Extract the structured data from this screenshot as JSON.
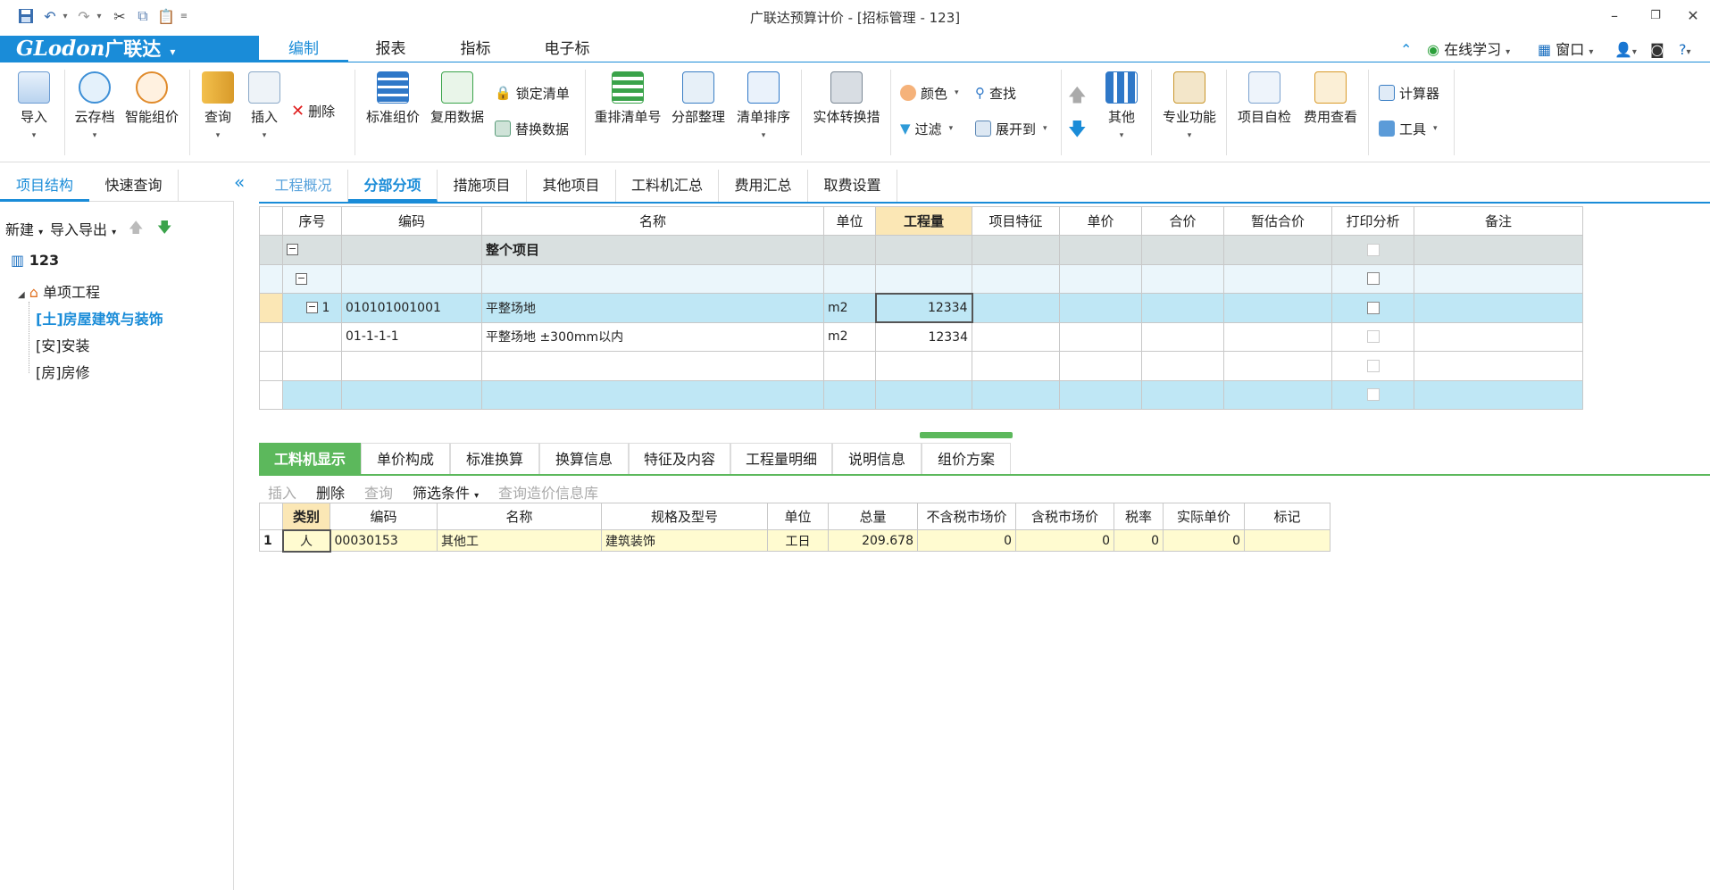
{
  "app": {
    "title": "广联达预算计价 - [招标管理 - 123]"
  },
  "logo": {
    "brand": "GLodon",
    "cn": "广联达",
    "arrow": "▾"
  },
  "menu": {
    "tabs": [
      "编制",
      "报表",
      "指标",
      "电子标"
    ],
    "right": {
      "online": "在线学习",
      "window": "窗口"
    }
  },
  "ribbon": {
    "import": "导入",
    "cloud": "云存档",
    "smart": "智能组价",
    "query": "查询",
    "insert": "插入",
    "delete": "删除",
    "std_group": "标准组价",
    "reuse": "复用数据",
    "lock": "锁定清单",
    "replace": "替换数据",
    "renumber": "重排清单号",
    "organize": "分部整理",
    "sort": "清单排序",
    "convert": "实体转换措",
    "color": "颜色",
    "find": "查找",
    "filter": "过滤",
    "expand": "展开到",
    "other": "其他",
    "pro": "专业功能",
    "selfcheck": "项目自检",
    "feeview": "费用查看",
    "calculator": "计算器",
    "tools": "工具"
  },
  "left": {
    "tabs": [
      "项目结构",
      "快速查询"
    ],
    "toolbar": {
      "new": "新建",
      "io": "导入导出"
    },
    "tree": {
      "root": "123",
      "unit": "单项工程",
      "items": [
        "[土]房屋建筑与装饰",
        "[安]安装",
        "[房]房修"
      ]
    }
  },
  "main_tabs": [
    "工程概况",
    "分部分项",
    "措施项目",
    "其他项目",
    "工料机汇总",
    "费用汇总",
    "取费设置"
  ],
  "grid1": {
    "headers": [
      "序号",
      "编码",
      "名称",
      "单位",
      "工程量",
      "项目特征",
      "单价",
      "合价",
      "暂估合价",
      "打印分析",
      "备注"
    ],
    "rows": [
      {
        "seq": "",
        "code": "",
        "name": "整个项目",
        "unit": "",
        "qty": ""
      },
      {
        "seq": "",
        "code": "",
        "name": "",
        "unit": "",
        "qty": ""
      },
      {
        "seq": "1",
        "code": "010101001001",
        "name": "平整场地",
        "unit": "m2",
        "qty": "12334"
      },
      {
        "seq": "",
        "code": "01-1-1-1",
        "name": "平整场地 ±300mm以内",
        "unit": "m2",
        "qty": "12334"
      },
      {
        "seq": "",
        "code": "",
        "name": "",
        "unit": "",
        "qty": ""
      },
      {
        "seq": "",
        "code": "",
        "name": "",
        "unit": "",
        "qty": ""
      }
    ]
  },
  "bottom_tabs": [
    "工料机显示",
    "单价构成",
    "标准换算",
    "换算信息",
    "特征及内容",
    "工程量明细",
    "说明信息",
    "组价方案"
  ],
  "bottom_toolbar": {
    "insert": "插入",
    "delete": "删除",
    "query": "查询",
    "filter": "筛选条件",
    "price_lib": "查询造价信息库"
  },
  "grid2": {
    "headers": [
      "类别",
      "编码",
      "名称",
      "规格及型号",
      "单位",
      "总量",
      "不含税市场价",
      "含税市场价",
      "税率",
      "实际单价",
      "标记"
    ],
    "rows": [
      {
        "no": "1",
        "type": "人",
        "code": "00030153",
        "name": "其他工",
        "spec": "建筑装饰",
        "unit": "工日",
        "total": "209.678",
        "price_ex": "0",
        "price_in": "0",
        "tax": "0",
        "actual": "0",
        "mark": ""
      }
    ]
  },
  "colors": {
    "accent": "#1a8cd8",
    "green": "#5cb85c",
    "row_blue": "#bfe7f5",
    "row_yellow": "#fffbd0"
  }
}
